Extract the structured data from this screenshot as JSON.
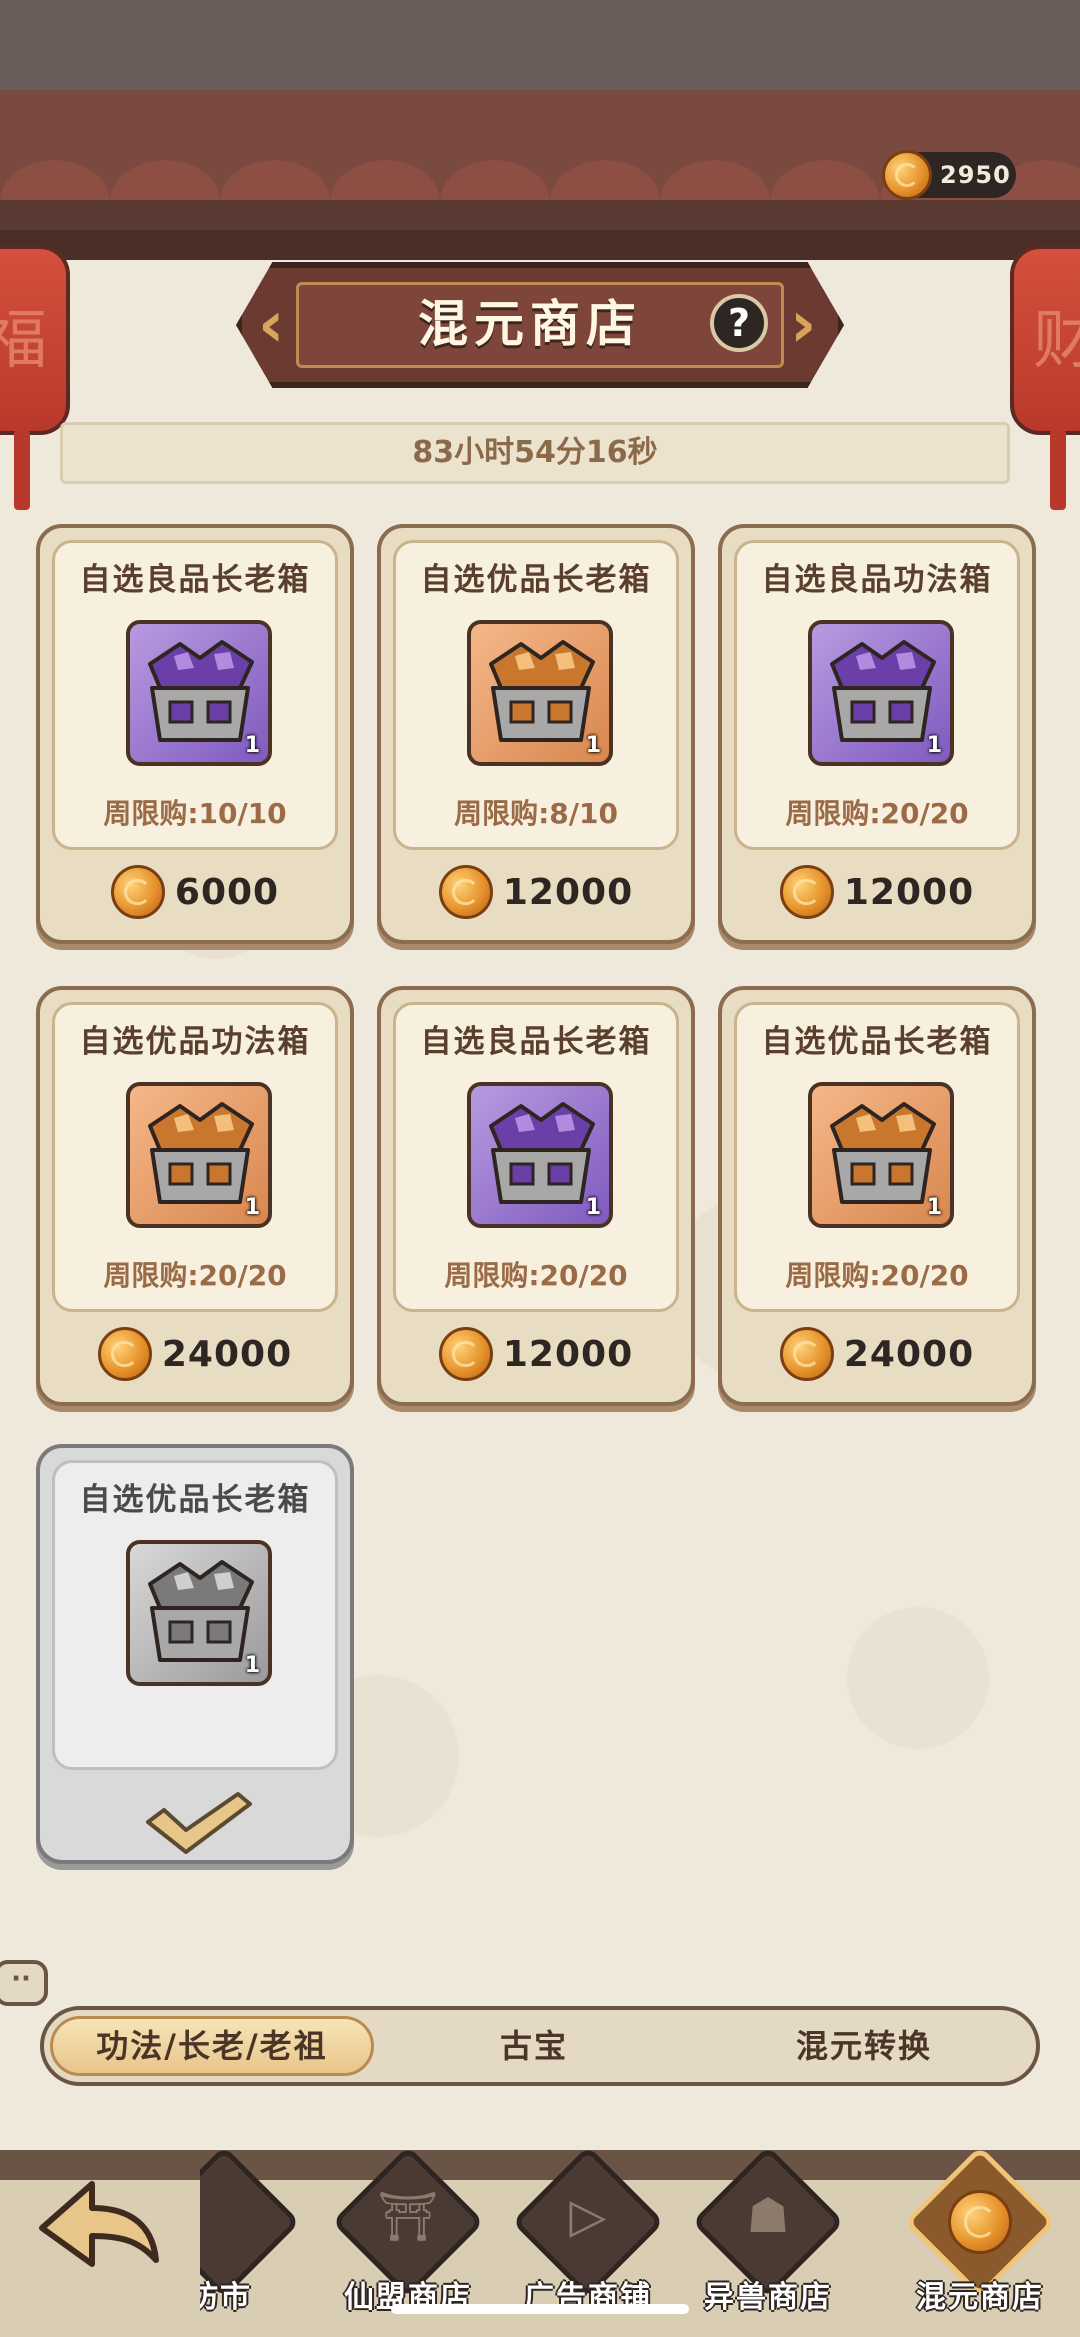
{
  "header": {
    "title": "混元商店",
    "help_icon": "question-icon",
    "coin_balance": "2950",
    "timer": "83小时54分16秒",
    "lantern_glyph_left": "福",
    "lantern_glyph_right": "财"
  },
  "items": [
    {
      "name": "自选良品长老箱",
      "limit": "周限购:10/10",
      "price": "6000",
      "qty": "1",
      "tier": "purple",
      "icon": "chest-purple-icon"
    },
    {
      "name": "自选优品长老箱",
      "limit": "周限购:8/10",
      "price": "12000",
      "qty": "1",
      "tier": "orange",
      "icon": "chest-gold-icon"
    },
    {
      "name": "自选良品功法箱",
      "limit": "周限购:20/20",
      "price": "12000",
      "qty": "1",
      "tier": "purple",
      "icon": "chest-purple-scroll-icon"
    },
    {
      "name": "自选优品功法箱",
      "limit": "周限购:20/20",
      "price": "24000",
      "qty": "1",
      "tier": "orange",
      "icon": "chest-gold-scroll-icon"
    },
    {
      "name": "自选良品长老箱",
      "limit": "周限购:20/20",
      "price": "12000",
      "qty": "1",
      "tier": "purple",
      "icon": "chest-purple-icon"
    },
    {
      "name": "自选优品长老箱",
      "limit": "周限购:20/20",
      "price": "24000",
      "qty": "1",
      "tier": "orange",
      "icon": "chest-gold-icon"
    },
    {
      "name": "自选优品长老箱",
      "qty": "1",
      "tier": "gray",
      "icon": "chest-gray-icon",
      "sold_out": true
    }
  ],
  "tabs": [
    {
      "label": "功法/长老/老祖",
      "active": true
    },
    {
      "label": "古宝",
      "active": false
    },
    {
      "label": "混元转换",
      "active": false
    }
  ],
  "bottom_nav": [
    {
      "label": "坊市",
      "icon": "market-icon"
    },
    {
      "label": "仙盟商店",
      "icon": "guild-shop-icon"
    },
    {
      "label": "广告商铺",
      "icon": "video-ad-icon"
    },
    {
      "label": "异兽商店",
      "icon": "beast-shop-icon"
    },
    {
      "label": "混元商店",
      "icon": "hunyuan-shop-icon",
      "active": true
    }
  ],
  "colors": {
    "accent_gold": "#e8c589",
    "roof": "#7a4a40",
    "card_bg": "#e8ddc2",
    "price_text": "#2e2622"
  }
}
